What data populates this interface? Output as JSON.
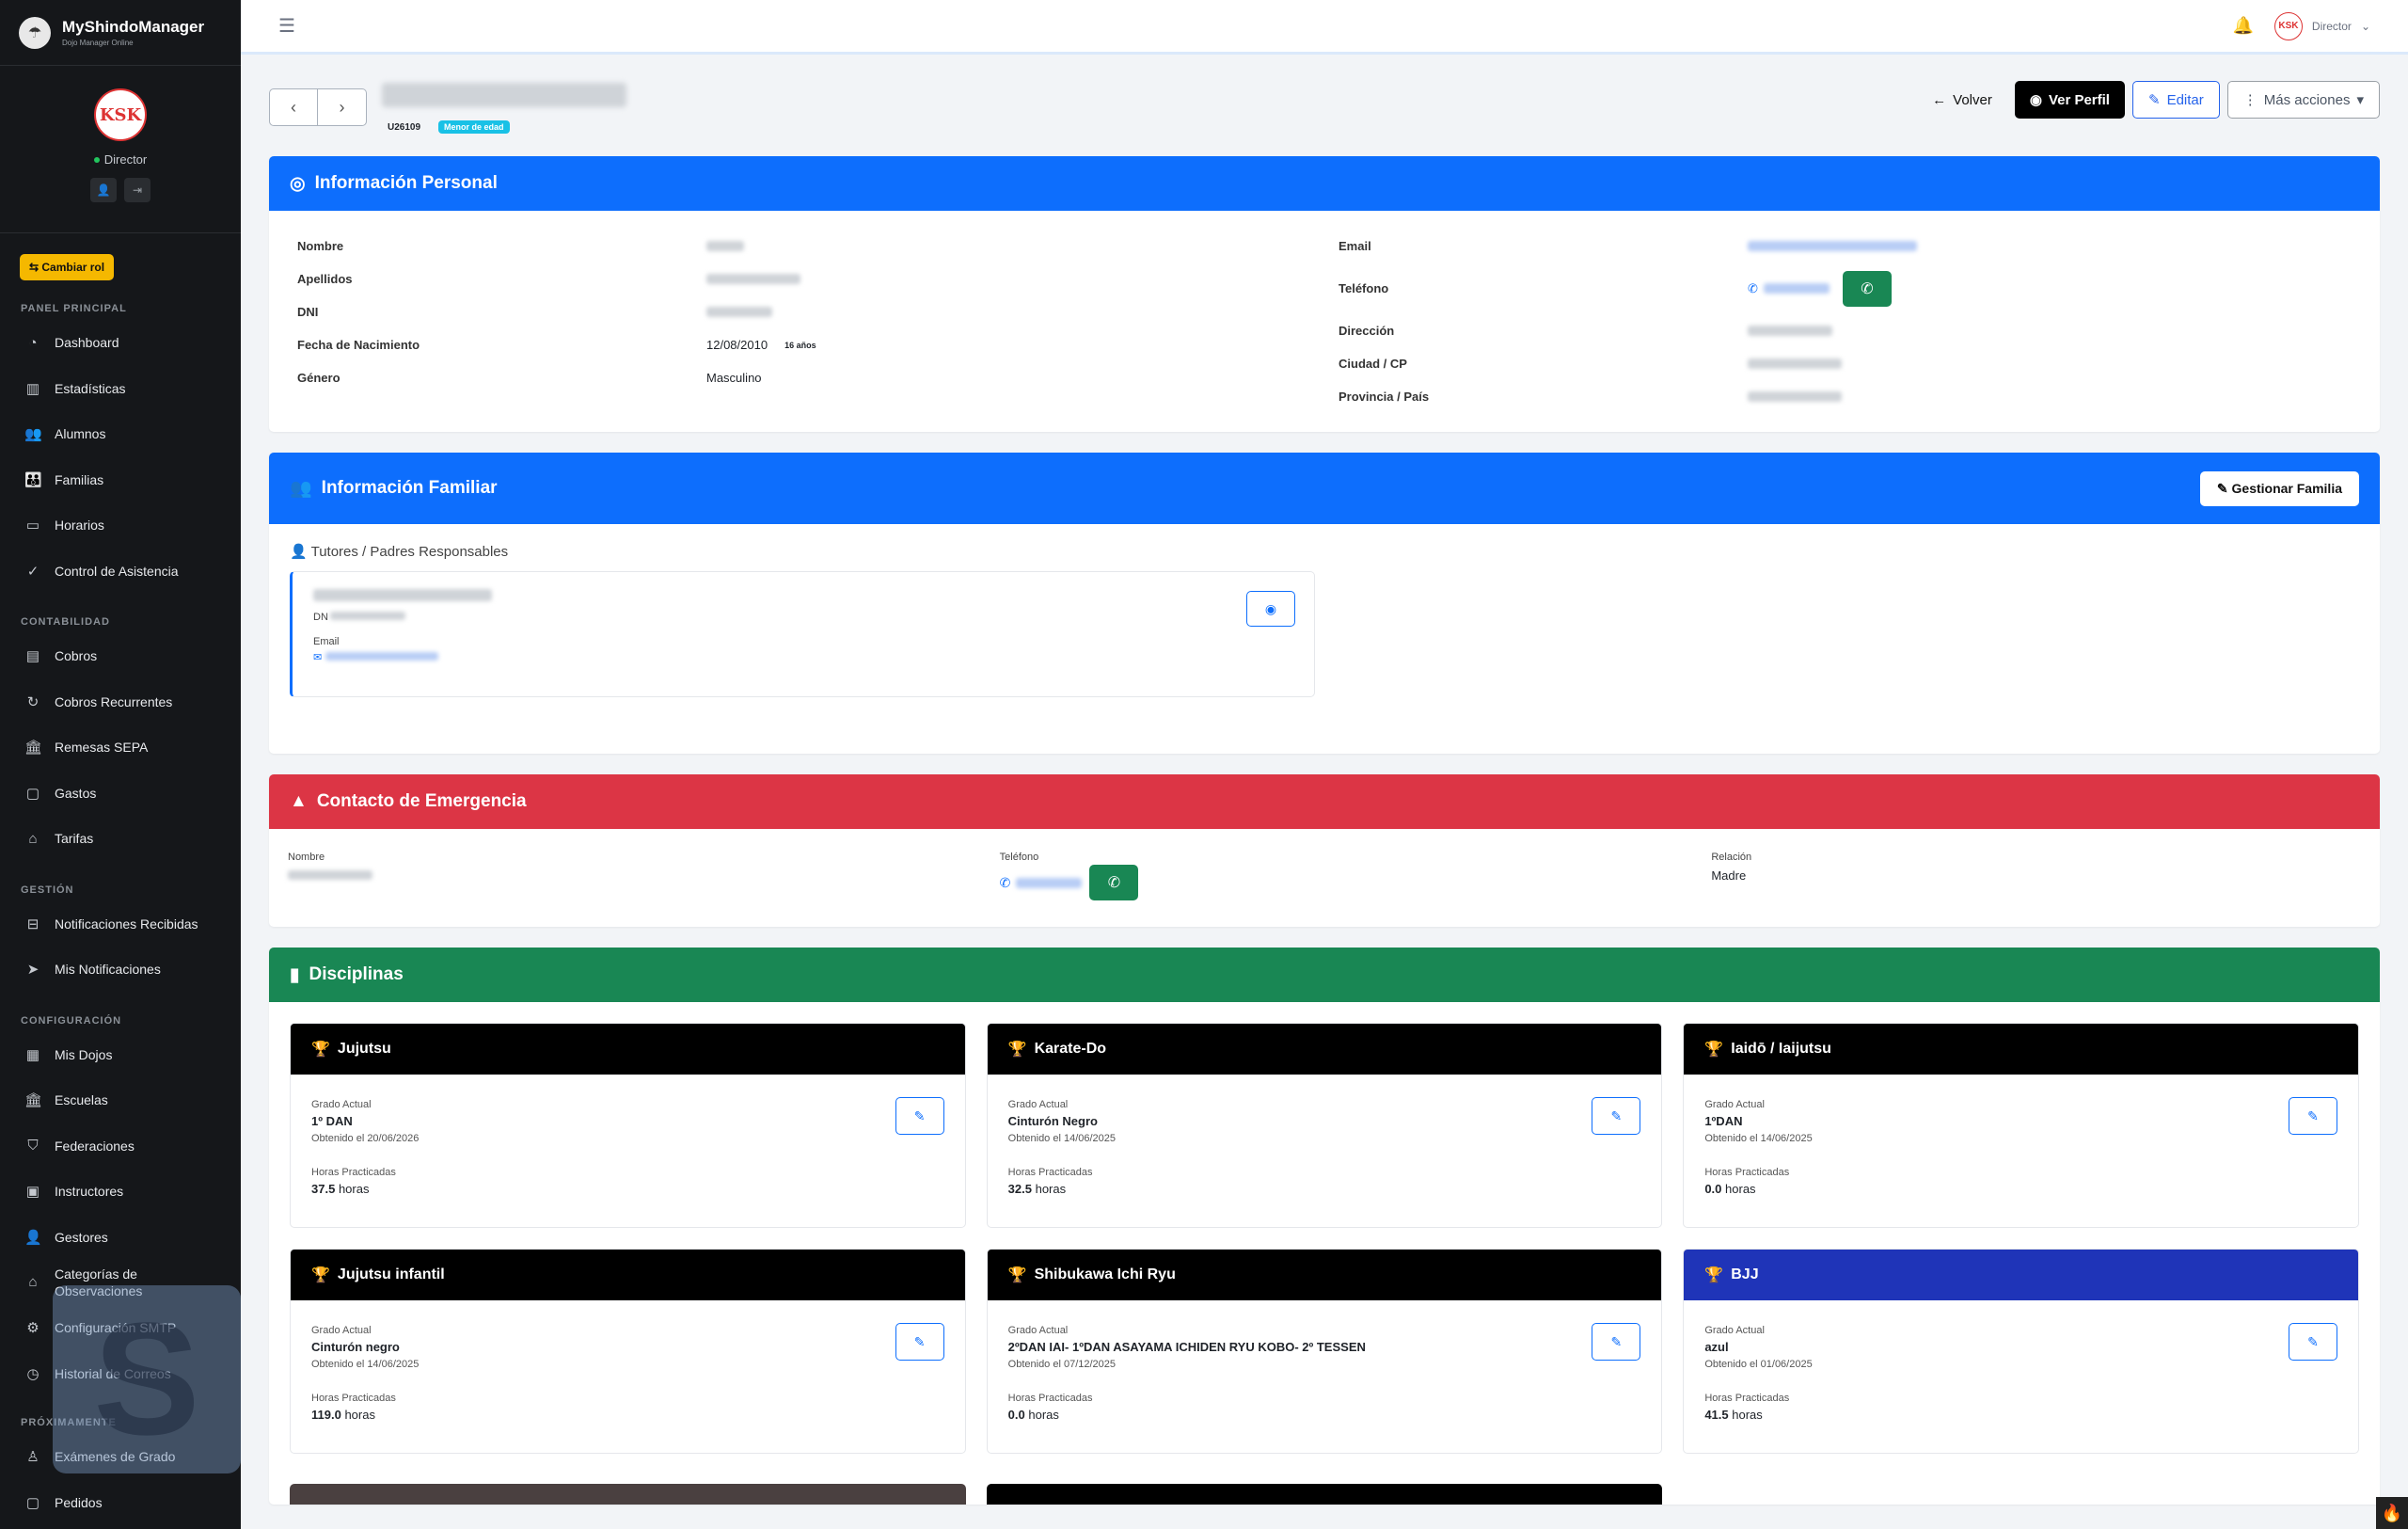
{
  "sidebar": {
    "brand_name": "MyShindoManager",
    "brand_sub": "Dojo Manager Online",
    "avatar_text": "KSK",
    "role": "Director",
    "change_role": "⇆ Cambiar rol",
    "sections": {
      "panel": "PANEL PRINCIPAL",
      "contabilidad": "CONTABILIDAD",
      "gestion": "GESTIÓN",
      "config": "CONFIGURACIÓN",
      "proximamente": "PRÓXIMAMENTE"
    },
    "items": {
      "dashboard": "Dashboard",
      "estadisticas": "Estadísticas",
      "alumnos": "Alumnos",
      "familias": "Familias",
      "horarios": "Horarios",
      "asistencia": "Control de Asistencia",
      "cobros": "Cobros",
      "cobros_rec": "Cobros Recurrentes",
      "remesas": "Remesas SEPA",
      "gastos": "Gastos",
      "tarifas": "Tarifas",
      "notif_rec": "Notificaciones Recibidas",
      "mis_notif": "Mis Notificaciones",
      "dojos": "Mis Dojos",
      "escuelas": "Escuelas",
      "federaciones": "Federaciones",
      "instructores": "Instructores",
      "gestores": "Gestores",
      "categorias": "Categorías de Observaciones",
      "smtp": "Configuración SMTP",
      "historial": "Historial de Correos",
      "examenes": "Exámenes de Grado",
      "pedidos": "Pedidos"
    }
  },
  "topbar": {
    "user_role": "Director"
  },
  "header": {
    "id_code": "U26109",
    "minor_badge": "Menor de edad",
    "back": "Volver",
    "view_profile": "Ver Perfil",
    "edit": "Editar",
    "more": "Más acciones"
  },
  "personal": {
    "title": "Información Personal",
    "labels": {
      "nombre": "Nombre",
      "apellidos": "Apellidos",
      "dni": "DNI",
      "nacimiento": "Fecha de Nacimiento",
      "genero": "Género",
      "email": "Email",
      "telefono": "Teléfono",
      "direccion": "Dirección",
      "ciudad": "Ciudad / CP",
      "provincia": "Provincia / País"
    },
    "birth_date": "12/08/2010",
    "age": "16 años",
    "gender": "Masculino"
  },
  "family": {
    "title": "Información Familiar",
    "manage": "Gestionar Familia",
    "tutors_title": "Tutores / Padres Responsables",
    "dni_label": "DN",
    "email_label": "Email"
  },
  "emergency": {
    "title": "Contacto de Emergencia",
    "name_label": "Nombre",
    "phone_label": "Teléfono",
    "relation_label": "Relación",
    "relation": "Madre"
  },
  "disciplines": {
    "title": "Disciplinas",
    "grade_label": "Grado Actual",
    "hours_label": "Horas Practicadas",
    "items": [
      {
        "name": "Jujutsu",
        "grade": "1º DAN",
        "obtained": "Obtenido el 20/06/2026",
        "hours": "37.5",
        "unit": "horas"
      },
      {
        "name": "Karate-Do",
        "grade": "Cinturón Negro",
        "obtained": "Obtenido el 14/06/2025",
        "hours": "32.5",
        "unit": "horas"
      },
      {
        "name": "Iaidō / Iaijutsu",
        "grade": "1ºDAN",
        "obtained": "Obtenido el 14/06/2025",
        "hours": "0.0",
        "unit": "horas"
      },
      {
        "name": "Jujutsu infantil",
        "grade": "Cinturón negro",
        "obtained": "Obtenido el 14/06/2025",
        "hours": "119.0",
        "unit": "horas"
      },
      {
        "name": "Shibukawa Ichi Ryu",
        "grade": "2ºDAN IAI- 1ºDAN ASAYAMA ICHIDEN RYU KOBO- 2º TESSEN",
        "obtained": "Obtenido el 07/12/2025",
        "hours": "0.0",
        "unit": "horas"
      },
      {
        "name": "BJJ",
        "grade": "azul",
        "obtained": "Obtenido el 01/06/2025",
        "hours": "41.5",
        "unit": "horas"
      }
    ]
  }
}
